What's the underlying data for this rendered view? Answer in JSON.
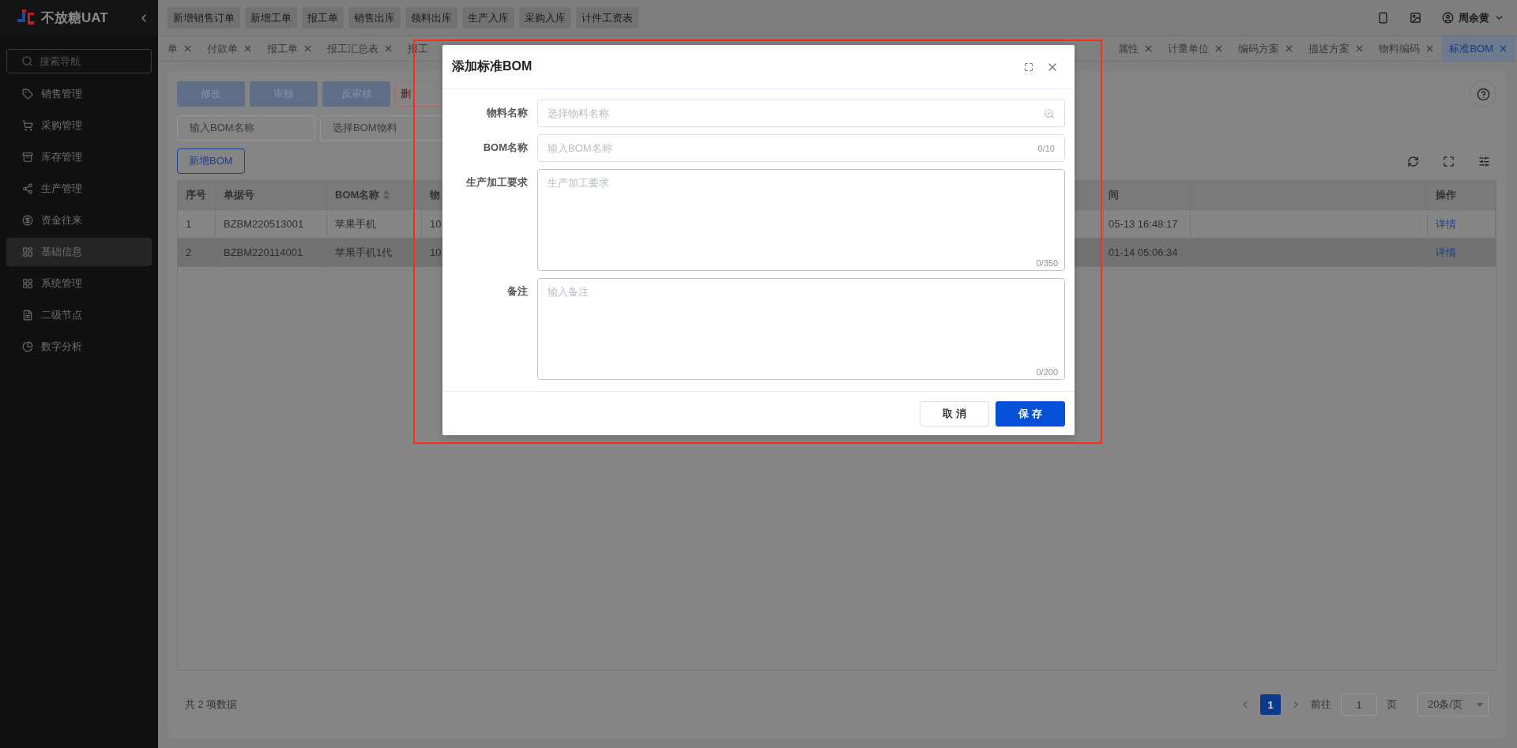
{
  "app": {
    "name": "不放糖UAT"
  },
  "sidebar": {
    "search_placeholder": "搜索导航",
    "items": [
      {
        "label": "销售管理",
        "selected": false
      },
      {
        "label": "采购管理",
        "selected": false
      },
      {
        "label": "库存管理",
        "selected": false
      },
      {
        "label": "生产管理",
        "selected": false
      },
      {
        "label": "资金往来",
        "selected": false
      },
      {
        "label": "基础信息",
        "selected": true
      },
      {
        "label": "系统管理",
        "selected": false
      },
      {
        "label": "二级节点",
        "selected": false
      },
      {
        "label": "数字分析",
        "selected": false
      }
    ]
  },
  "quick_actions": [
    "新增销售订单",
    "新增工单",
    "报工单",
    "销售出库",
    "领料出库",
    "生产入库",
    "采购入库",
    "计件工资表"
  ],
  "user": {
    "name": "周余黄"
  },
  "tabs": {
    "left": [
      {
        "label": "单",
        "selected": false,
        "closable": true
      },
      {
        "label": "付款单",
        "selected": false,
        "closable": true
      },
      {
        "label": "报工单",
        "selected": false,
        "closable": true
      },
      {
        "label": "报工汇总表",
        "selected": false,
        "closable": true
      },
      {
        "label": "报工",
        "selected": false,
        "closable": false
      }
    ],
    "right": [
      {
        "label": "属性",
        "selected": false,
        "closable": true
      },
      {
        "label": "计量单位",
        "selected": false,
        "closable": true
      },
      {
        "label": "编码方案",
        "selected": false,
        "closable": true
      },
      {
        "label": "描述方案",
        "selected": false,
        "closable": true
      },
      {
        "label": "物料编码",
        "selected": false,
        "closable": true
      },
      {
        "label": "标准BOM",
        "selected": true,
        "closable": true
      }
    ]
  },
  "toolbar": [
    {
      "label": "修改",
      "kind": "primary",
      "disabled": true
    },
    {
      "label": "审核",
      "kind": "primary",
      "disabled": true
    },
    {
      "label": "反审核",
      "kind": "primary",
      "disabled": true
    },
    {
      "label": "删",
      "kind": "danger",
      "disabled": true
    }
  ],
  "filters": [
    {
      "placeholder": "输入BOM名称"
    },
    {
      "placeholder": "选择BOM物料"
    }
  ],
  "add_button": "新增BOM",
  "table": {
    "columns": [
      {
        "label": "序号",
        "sortable": false
      },
      {
        "label": "单据号",
        "sortable": false
      },
      {
        "label": "BOM名称",
        "sortable": true
      },
      {
        "label": "物",
        "sortable": false
      },
      {
        "label": "间",
        "sortable": false
      }
    ],
    "action_column": "操作",
    "rows": [
      {
        "cells": [
          "1",
          "BZBM220513001",
          "苹果手机",
          "10",
          "05-13 16:48:17"
        ],
        "action": "详情",
        "selected": false
      },
      {
        "cells": [
          "2",
          "BZBM220114001",
          "苹果手机1代",
          "10",
          "01-14 05:06:34"
        ],
        "action": "详情",
        "selected": true
      }
    ]
  },
  "pagination": {
    "total": "共 2 项数据",
    "pages": [
      {
        "label": "1",
        "selected": true
      }
    ],
    "goto_label": "前往",
    "goto_value": "1",
    "goto_suffix": "页",
    "page_size": "20条/页"
  },
  "dialog": {
    "title": "添加标准BOM",
    "fields": [
      {
        "label": "物料名称",
        "kind": "select",
        "placeholder": "选择物料名称"
      },
      {
        "label": "BOM名称",
        "kind": "input",
        "placeholder": "输入BOM名称",
        "counter": "0/10"
      },
      {
        "label": "生产加工要求",
        "kind": "textarea",
        "placeholder": "生产加工要求",
        "counter": "0/350"
      },
      {
        "label": "备注",
        "kind": "textarea",
        "placeholder": "输入备注",
        "counter": "0/200"
      }
    ],
    "buttons": [
      {
        "label": "取 消",
        "kind": "default"
      },
      {
        "label": "保 存",
        "kind": "primary"
      }
    ]
  }
}
